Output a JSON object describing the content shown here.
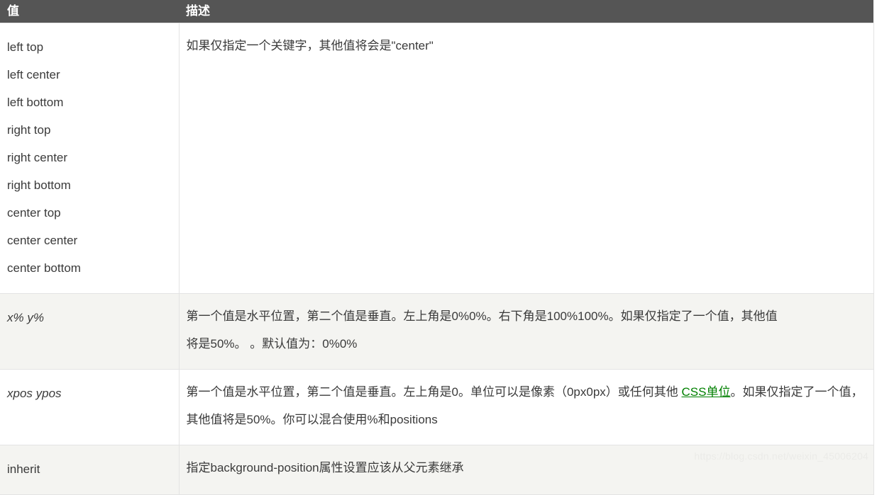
{
  "table": {
    "headers": {
      "value": "值",
      "description": "描述"
    },
    "rows": [
      {
        "id": "keyword-row",
        "value_items": [
          "left top",
          "left center",
          "left bottom",
          "right top",
          "right center",
          "right bottom",
          "center top",
          "center center",
          "center bottom"
        ],
        "description_lines": [
          "如果仅指定一个关键字，其他值将会是\"center\""
        ],
        "background": "#ffffff"
      },
      {
        "id": "percent-row",
        "value_label": "x% y%",
        "description_lines": [
          "第一个值是水平位置，第二个值是垂直。左上角是0%0%。右下角是100%100%。如果仅指定了一个值，其他值",
          "将是50%。 。默认值为：0%0%"
        ],
        "background": "#f4f4f1"
      },
      {
        "id": "xpos-ypos-row",
        "value_label": "xpos ypos",
        "description_parts": {
          "before_link": "第一个值是水平位置，第二个值是垂直。左上角是0。单位可以是像素（0px0px）或任何其他 ",
          "link_text": "CSS单位",
          "after_link": "。如果仅指定了一个值，其他值将是50%。你可以混合使用%和positions"
        },
        "background": "#ffffff"
      },
      {
        "id": "inherit-row",
        "value_label": "inherit",
        "description_lines": [
          "指定background-position属性设置应该从父元素继承"
        ],
        "background": "#f4f4f1"
      }
    ]
  },
  "watermark": {
    "text": "https://blog.csdn.net/weixin_45006204"
  },
  "colors": {
    "header_background": "#555555",
    "header_text": "#ffffff",
    "zebra_background": "#f4f4f1",
    "body_text": "#3a3a3a",
    "border": "#e3e3e3",
    "link": "#008000",
    "watermark": "#ebebe8"
  }
}
